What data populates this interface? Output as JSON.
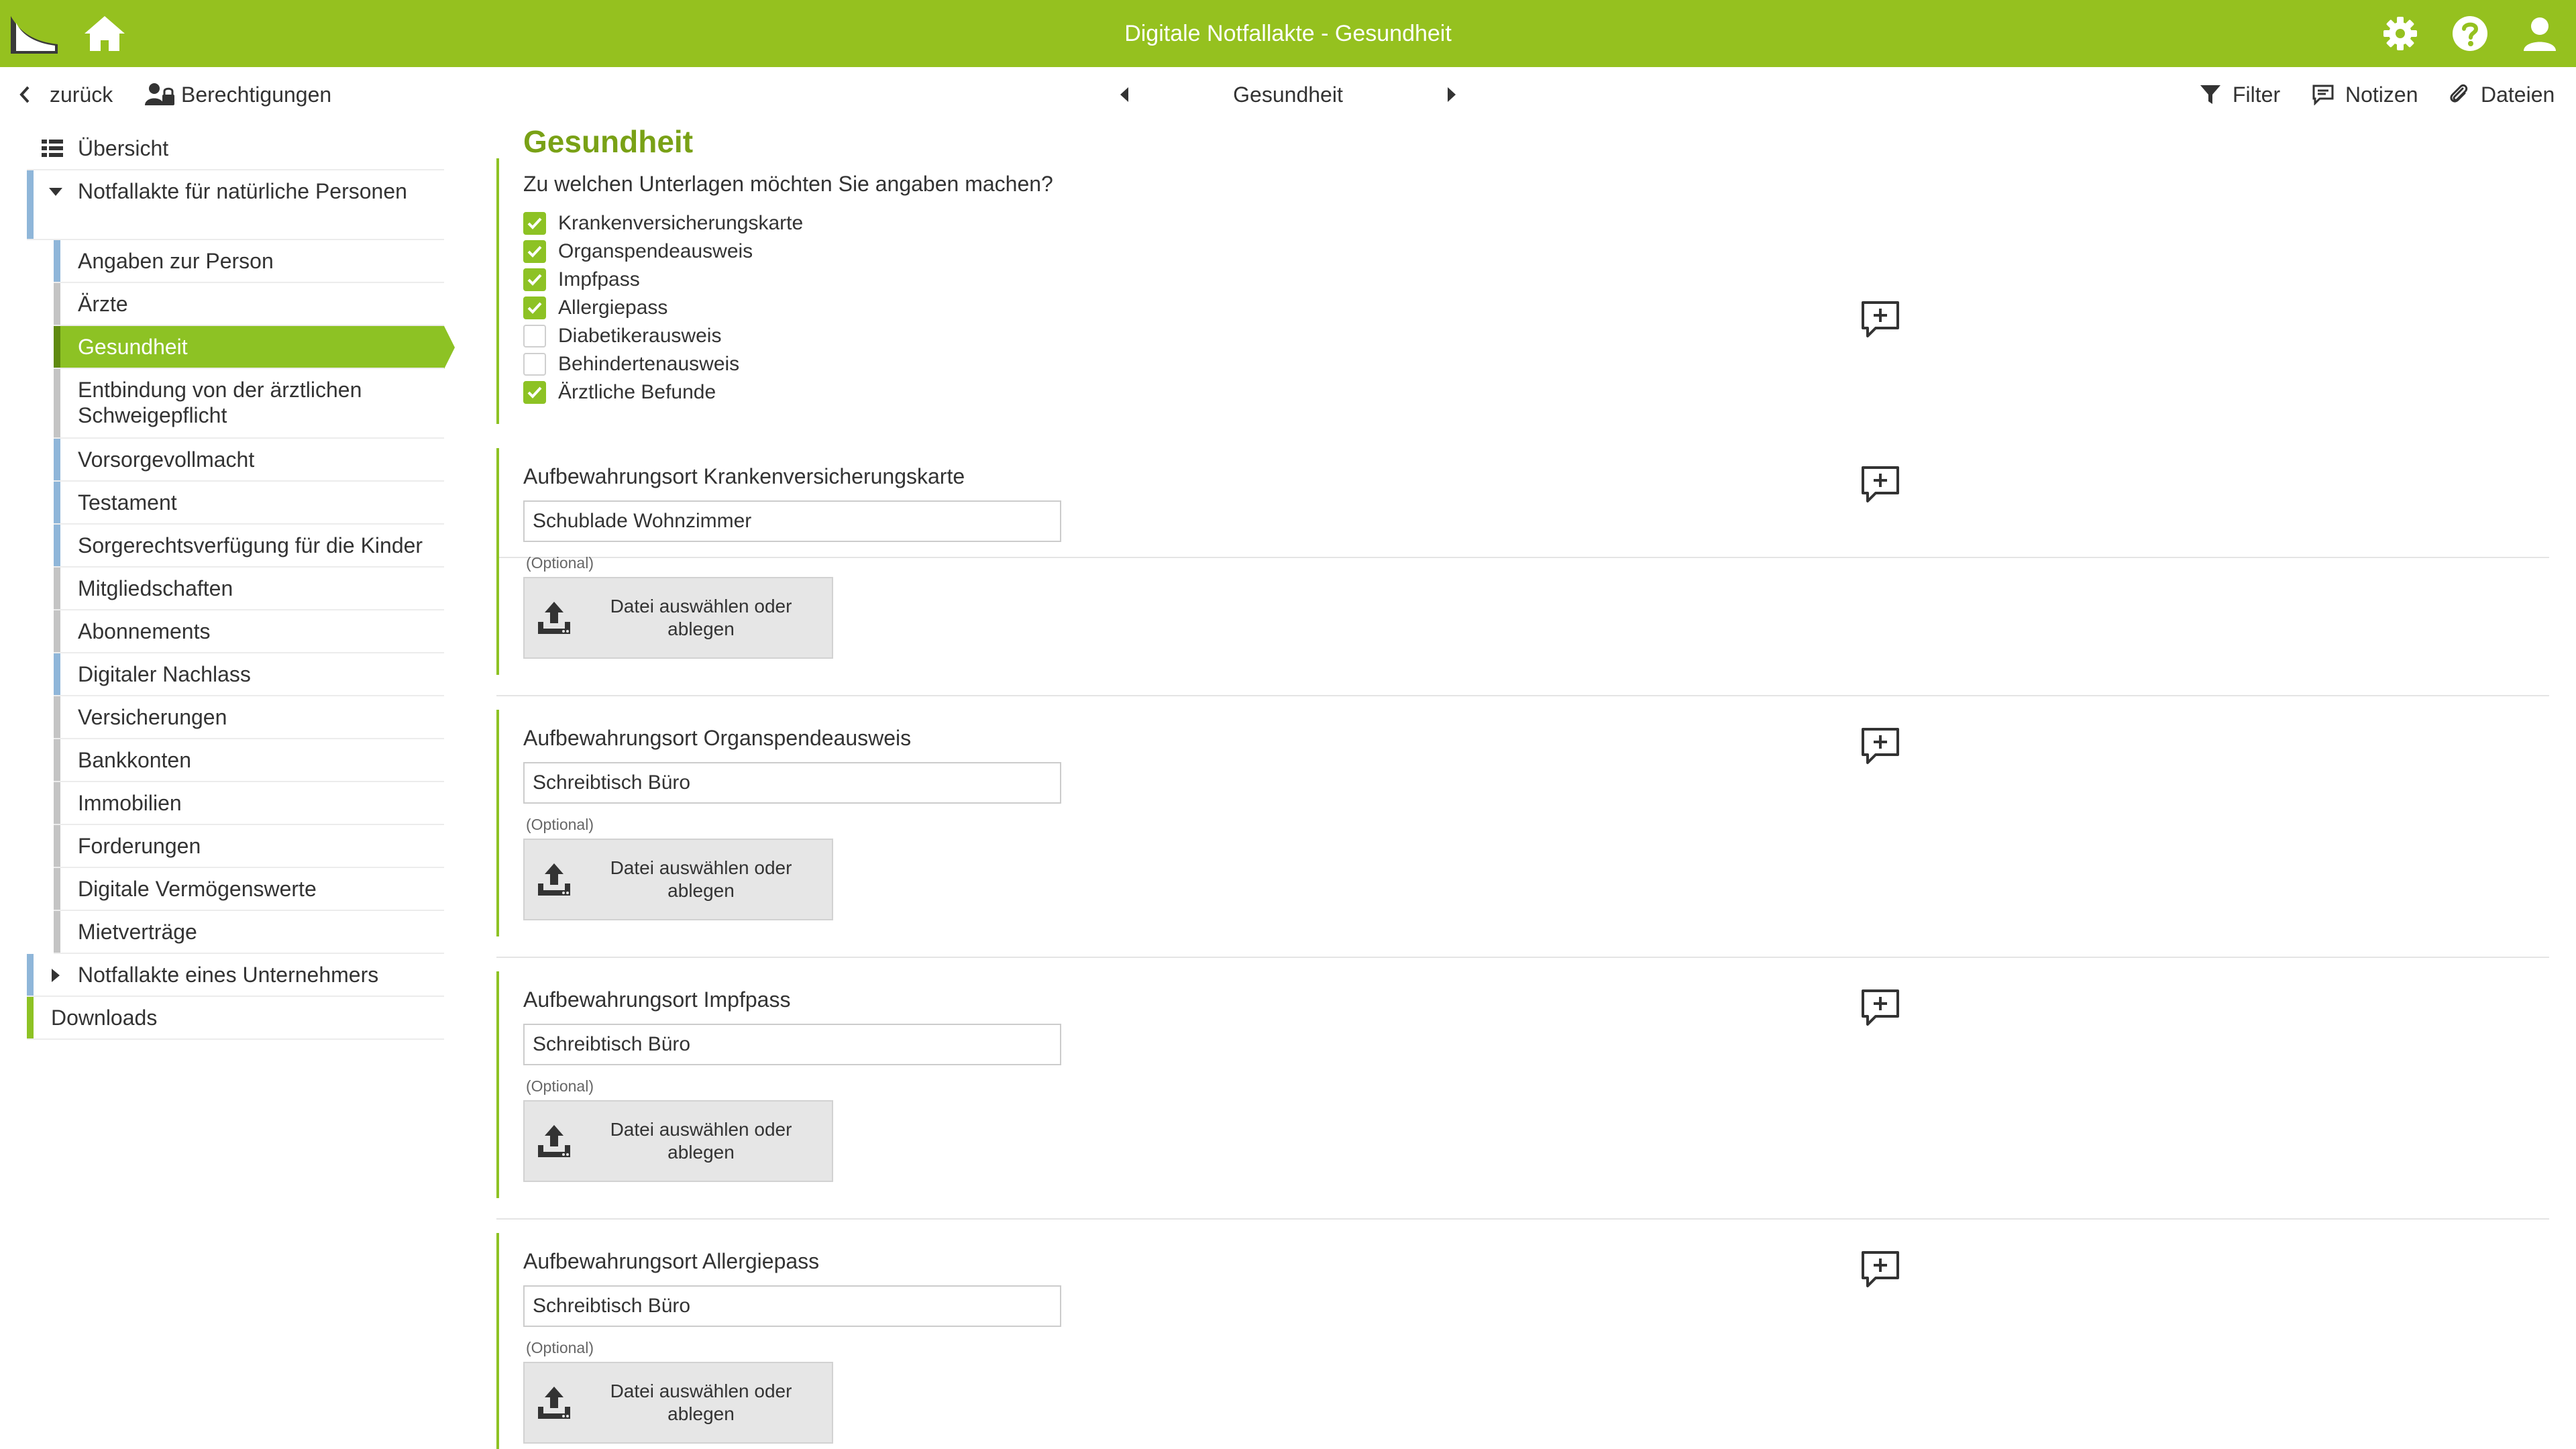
{
  "header": {
    "title": "Digitale Notfallakte - Gesundheit",
    "bg_color": "#95c11f",
    "icons": [
      "logo-icon",
      "home-icon",
      "settings-icon",
      "help-icon",
      "user-icon"
    ]
  },
  "toolbar": {
    "back_label": "zurück",
    "permissions_label": "Berechtigungen",
    "section_label": "Gesundheit",
    "filter_label": "Filter",
    "notes_label": "Notizen",
    "files_label": "Dateien"
  },
  "sidebar": {
    "overview_label": "Übersicht",
    "group1_label": "Notfallakte für natürliche Personen",
    "items": [
      {
        "label": "Angaben zur Person"
      },
      {
        "label": "Ärzte"
      },
      {
        "label": "Gesundheit",
        "active": true
      },
      {
        "label": "Entbindung von der ärztlichen Schweigepflicht"
      },
      {
        "label": "Vorsorgevollmacht"
      },
      {
        "label": "Testament"
      },
      {
        "label": "Sorgerechtsverfügung für die Kinder"
      },
      {
        "label": "Mitgliedschaften"
      },
      {
        "label": "Abonnements"
      },
      {
        "label": "Digitaler Nachlass"
      },
      {
        "label": "Versicherungen"
      },
      {
        "label": "Bankkonten"
      },
      {
        "label": "Immobilien"
      },
      {
        "label": "Forderungen"
      },
      {
        "label": "Digitale Vermögenswerte"
      },
      {
        "label": "Mietverträge"
      }
    ],
    "group2_label": "Notfallakte eines Unternehmers",
    "downloads_label": "Downloads",
    "active_color": "#8dc224"
  },
  "main": {
    "title": "Gesundheit",
    "question": "Zu welchen Unterlagen möchten Sie angaben machen?",
    "documents": [
      {
        "label": "Krankenversicherungskarte",
        "checked": true
      },
      {
        "label": "Organspendeausweis",
        "checked": true
      },
      {
        "label": "Impfpass",
        "checked": true
      },
      {
        "label": "Allergiepass",
        "checked": true
      },
      {
        "label": "Diabetikerausweis",
        "checked": false
      },
      {
        "label": "Behindertenausweis",
        "checked": false
      },
      {
        "label": "Ärztliche Befunde",
        "checked": true
      }
    ],
    "storage": [
      {
        "label": "Aufbewahrungsort Krankenversicherungskarte",
        "value": "Schublade Wohnzimmer",
        "optional": "(Optional)",
        "upload": "Datei auswählen oder ablegen"
      },
      {
        "label": "Aufbewahrungsort Organspendeausweis",
        "value": "Schreibtisch Büro",
        "optional": "(Optional)",
        "upload": "Datei auswählen oder ablegen"
      },
      {
        "label": "Aufbewahrungsort Impfpass",
        "value": "Schreibtisch Büro",
        "optional": "(Optional)",
        "upload": "Datei auswählen oder ablegen"
      },
      {
        "label": "Aufbewahrungsort Allergiepass",
        "value": "Schreibtisch Büro",
        "optional": "(Optional)",
        "upload": "Datei auswählen oder ablegen"
      }
    ]
  }
}
